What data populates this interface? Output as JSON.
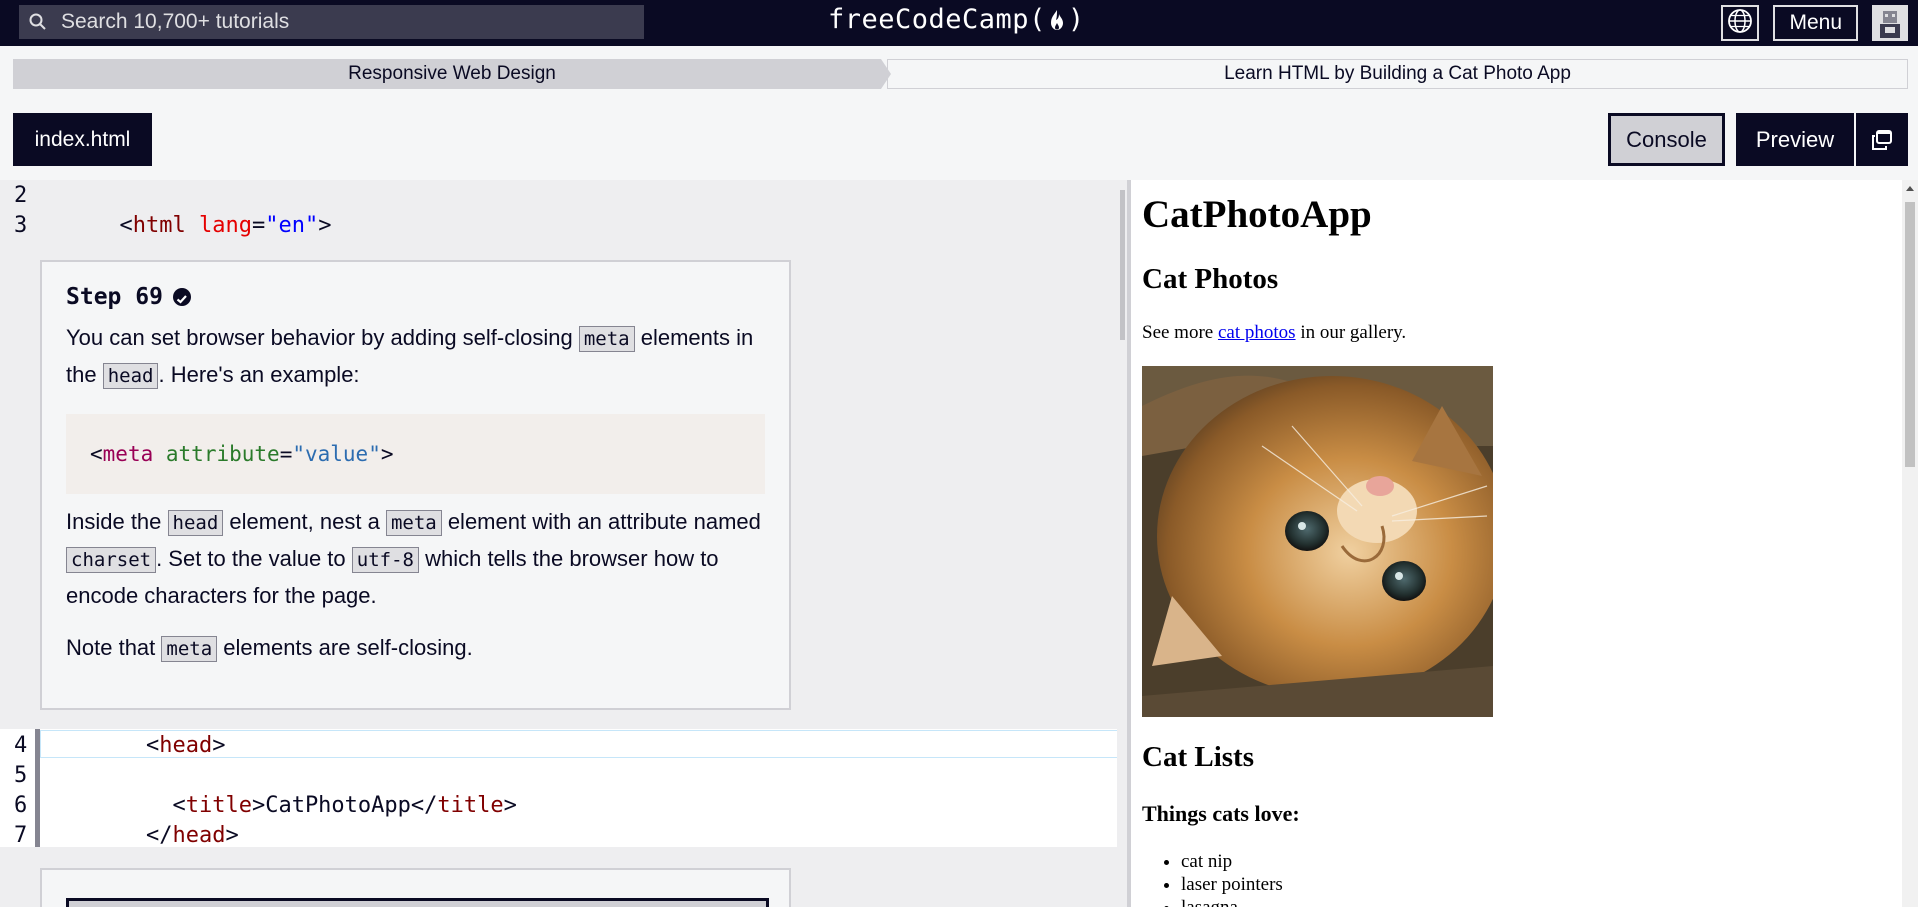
{
  "nav": {
    "search_placeholder": "Search 10,700+ tutorials",
    "logo": "freeCodeCamp",
    "logo_open": "(",
    "logo_close": ")",
    "menu_label": "Menu"
  },
  "breadcrumb": {
    "superblock": "Responsive Web Design",
    "block": "Learn HTML by Building a Cat Photo App"
  },
  "tabs": {
    "file": "index.html",
    "console": "Console",
    "preview": "Preview"
  },
  "editor": {
    "lines_top": [
      {
        "num": "2",
        "parts": []
      },
      {
        "num": "3",
        "parts": [
          {
            "cls": "tag",
            "text": "<"
          },
          {
            "cls": "tname",
            "text": "html"
          },
          {
            "cls": "txt",
            "text": " "
          },
          {
            "cls": "attr",
            "text": "lang"
          },
          {
            "cls": "tag",
            "text": "="
          },
          {
            "cls": "aval",
            "text": "\"en\""
          },
          {
            "cls": "tag",
            "text": ">"
          }
        ]
      }
    ],
    "lines_editable": [
      {
        "num": "4",
        "parts": [
          {
            "cls": "txt",
            "text": "  "
          },
          {
            "cls": "tag",
            "text": "<"
          },
          {
            "cls": "tname",
            "text": "head"
          },
          {
            "cls": "tag",
            "text": ">"
          }
        ]
      },
      {
        "num": "5",
        "parts": []
      },
      {
        "num": "6",
        "parts": [
          {
            "cls": "txt",
            "text": "    "
          },
          {
            "cls": "tag",
            "text": "<"
          },
          {
            "cls": "tname",
            "text": "title"
          },
          {
            "cls": "tag",
            "text": ">"
          },
          {
            "cls": "txt",
            "text": "CatPhotoApp"
          },
          {
            "cls": "tag",
            "text": "</"
          },
          {
            "cls": "tname",
            "text": "title"
          },
          {
            "cls": "tag",
            "text": ">"
          }
        ]
      },
      {
        "num": "7",
        "parts": [
          {
            "cls": "txt",
            "text": "  "
          },
          {
            "cls": "tag",
            "text": "</"
          },
          {
            "cls": "tname",
            "text": "head"
          },
          {
            "cls": "tag",
            "text": ">"
          }
        ]
      }
    ]
  },
  "step": {
    "title": "Step 69",
    "p1_a": "You can set browser behavior by adding self-closing ",
    "p1_code1": "meta",
    "p1_b": " elements in the ",
    "p1_code2": "head",
    "p1_c": ". Here's an example:",
    "example": {
      "open": "<",
      "tname": "meta",
      "space": " ",
      "attr": "attribute",
      "eq": "=",
      "aval": "\"value\"",
      "close": ">"
    },
    "p2_a": "Inside the ",
    "p2_code1": "head",
    "p2_b": " element, nest a ",
    "p2_code2": "meta",
    "p2_c": " element with an attribute named ",
    "p2_code3": "charset",
    "p2_d": ". Set to the value to ",
    "p2_code4": "utf-8",
    "p2_e": " which tells the browser how to encode characters for the page.",
    "p3_a": "Note that ",
    "p3_code1": "meta",
    "p3_b": " elements are self-closing."
  },
  "preview": {
    "h1": "CatPhotoApp",
    "h2_photos": "Cat Photos",
    "para_a": "See more ",
    "para_link": "cat photos",
    "para_b": " in our gallery.",
    "h2_lists": "Cat Lists",
    "h3_love": "Things cats love:",
    "list": [
      "cat nip",
      "laser pointers",
      "lasagna"
    ]
  },
  "colors": {
    "nav_bg": "#0a0a23",
    "search_bg": "#3b3b4f",
    "tag_name": "#800000",
    "attr_name": "#e50000",
    "attr_value": "#0000ff"
  },
  "icons": {
    "search": "search-icon",
    "flame": "flame-icon",
    "globe": "globe-icon",
    "avatar": "avatar-icon",
    "check": "check-circle-icon",
    "popout": "popout-icon"
  }
}
